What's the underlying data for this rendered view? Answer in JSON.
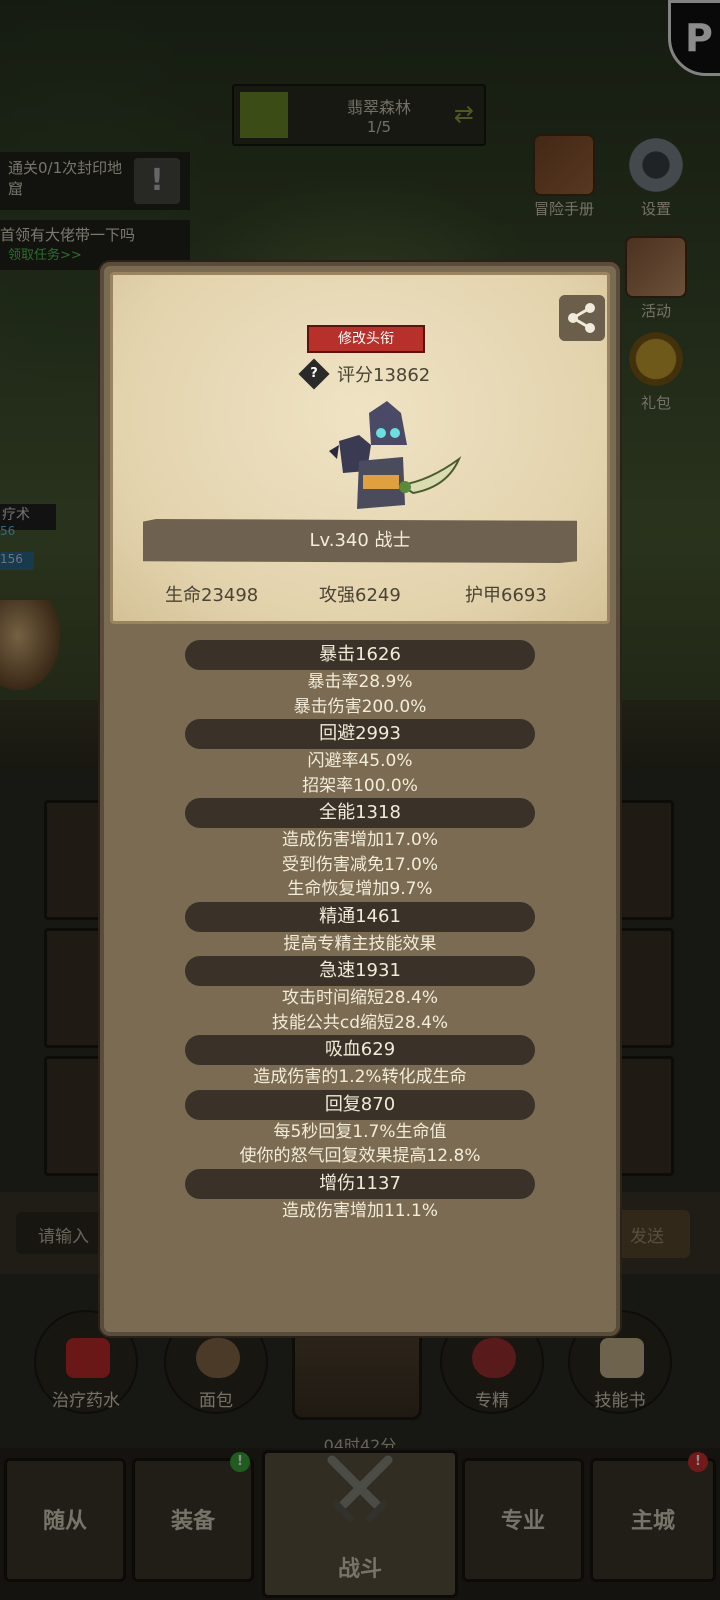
{
  "hud": {
    "zone_name": "翡翠森林",
    "zone_progress": "1/5",
    "quest_text": "通关0/1次封印地窟",
    "quest_alert": "!",
    "task_title": "首领有大佬带一下吗",
    "task_link": "领取任务>>",
    "pause": "P",
    "side_buttons": [
      {
        "label": "冒险手册",
        "icon": "book-icon"
      },
      {
        "label": "设置",
        "icon": "gear-icon"
      },
      {
        "label": "活动",
        "icon": "activity-icon"
      },
      {
        "label": "礼包",
        "icon": "gift-icon"
      }
    ],
    "skill_label": "疗术",
    "skill_value_a": "56",
    "skill_value_b": "156"
  },
  "chat": {
    "input_placeholder": "请输入",
    "send_label": "发送"
  },
  "quick_items": [
    {
      "label": "治疗药水"
    },
    {
      "label": "面包"
    },
    {
      "label": "专精"
    },
    {
      "label": "技能书"
    }
  ],
  "timer": "04时42分",
  "tabs": [
    {
      "label": "随从"
    },
    {
      "label": "装备",
      "badge": "!"
    },
    {
      "label": "战斗"
    },
    {
      "label": "专业"
    },
    {
      "label": "主城",
      "badge": "!"
    }
  ],
  "profile": {
    "title_button": "修改头衔",
    "score": "评分13862",
    "level_class": "Lv.340 战士",
    "hp": "生命23498",
    "attack": "攻强6249",
    "armor": "护甲6693",
    "help_icon": "?"
  },
  "stats": [
    {
      "head": "暴击1626",
      "lines": [
        "暴击率28.9%",
        "暴击伤害200.0%"
      ]
    },
    {
      "head": "回避2993",
      "lines": [
        "闪避率45.0%",
        "招架率100.0%"
      ]
    },
    {
      "head": "全能1318",
      "lines": [
        "造成伤害增加17.0%",
        "受到伤害减免17.0%",
        "生命恢复增加9.7%"
      ]
    },
    {
      "head": "精通1461",
      "lines": [
        "提高专精主技能效果"
      ]
    },
    {
      "head": "急速1931",
      "lines": [
        "攻击时间缩短28.4%",
        "技能公共cd缩短28.4%"
      ]
    },
    {
      "head": "吸血629",
      "lines": [
        "造成伤害的1.2%转化成生命"
      ]
    },
    {
      "head": "回复870",
      "lines": [
        "每5秒回复1.7%生命值",
        "使你的怒气回复效果提高12.8%"
      ]
    },
    {
      "head": "增伤1137",
      "lines": [
        "造成伤害增加11.1%"
      ]
    }
  ],
  "colors": {
    "title_button": "#b8302a",
    "green_badge": "#3aa83a",
    "red_badge": "#d03030",
    "task_link": "#4ec94e"
  }
}
